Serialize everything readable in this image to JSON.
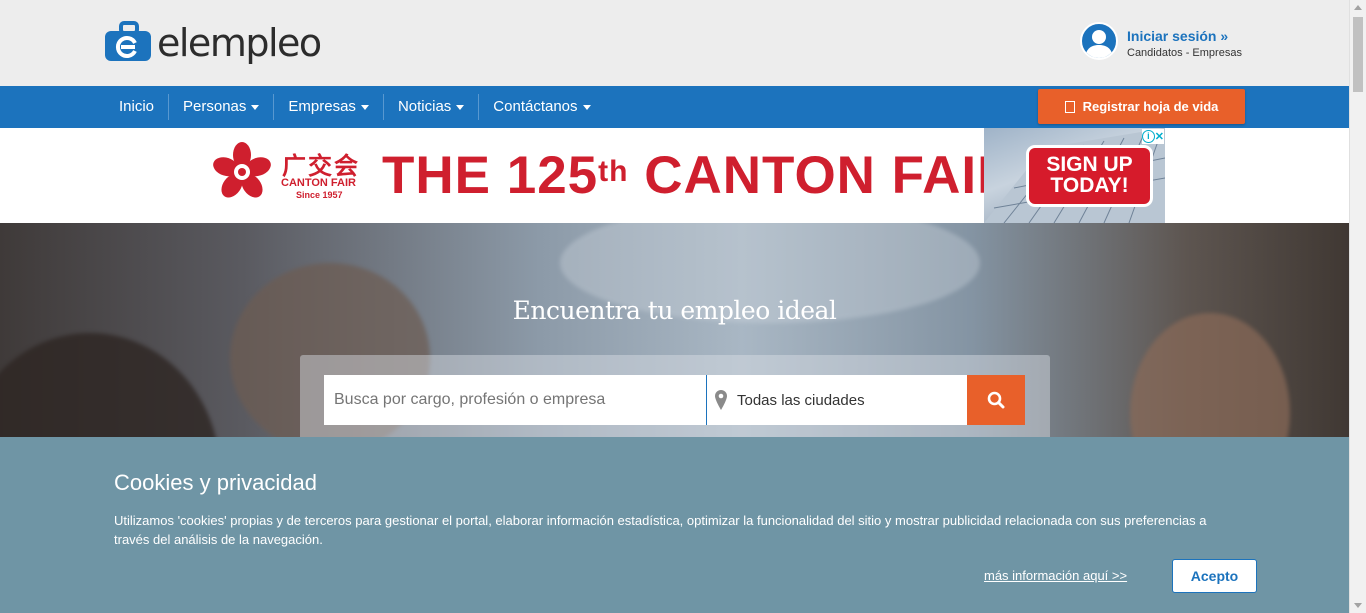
{
  "header": {
    "logo_text": "elempleo",
    "login_link": "Iniciar sesión »",
    "login_sub": "Candidatos - Empresas"
  },
  "nav": {
    "items": [
      {
        "label": "Inicio",
        "dropdown": false
      },
      {
        "label": "Personas",
        "dropdown": true
      },
      {
        "label": "Empresas",
        "dropdown": true
      },
      {
        "label": "Noticias",
        "dropdown": true
      },
      {
        "label": "Contáctanos",
        "dropdown": true
      }
    ],
    "register_label": "Registrar hoja de vida"
  },
  "ad": {
    "brand_cn": "广交会",
    "brand_en": "CANTON FAIR",
    "brand_since": "Since 1957",
    "headline_pre": "THE 125",
    "headline_sup": "th",
    "headline_post": " CANTON FAIR",
    "cta_line1": "SIGN UP",
    "cta_line2": "TODAY!",
    "choices_icon": "info-icon",
    "close_icon": "close-icon"
  },
  "hero": {
    "title": "Encuentra tu empleo ideal",
    "search_placeholder": "Busca por cargo, profesión o empresa",
    "city_value": "Todas las ciudades",
    "search_icon": "search-icon"
  },
  "cookie": {
    "title": "Cookies y privacidad",
    "text": "Utilizamos 'cookies' propias y de terceros para gestionar el portal, elaborar información estadística, optimizar la funcionalidad del sitio y mostrar publicidad relacionada con sus preferencias a través del análisis de la navegación.",
    "more_link": "más información aquí >>",
    "accept_label": "Acepto"
  },
  "colors": {
    "brand_blue": "#1c73bd",
    "accent_orange": "#e8602a",
    "cookie_bg": "#6f95a5",
    "ad_red": "#cf1f2e"
  }
}
